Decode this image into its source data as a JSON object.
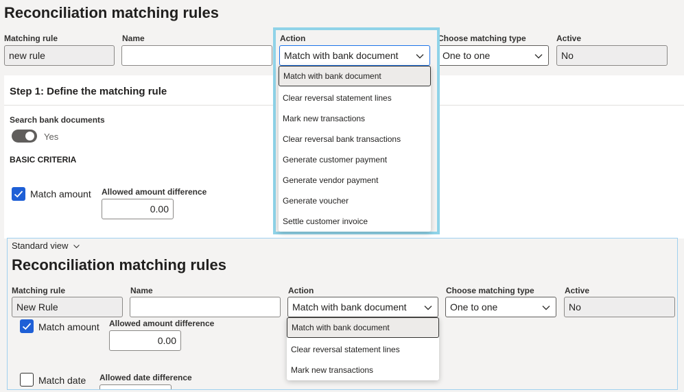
{
  "top": {
    "title": "Reconciliation matching rules",
    "labels": {
      "matching_rule": "Matching rule",
      "name": "Name",
      "action": "Action",
      "matching_type": "Choose matching type",
      "active": "Active"
    },
    "values": {
      "matching_rule": "new rule",
      "name": "",
      "action": "Match with bank document",
      "matching_type": "One to one",
      "active": "No"
    },
    "action_options": [
      "Match with bank document",
      "Clear reversal statement lines",
      "Mark new transactions",
      "Clear reversal bank transactions",
      "Generate customer payment",
      "Generate vendor payment",
      "Generate voucher",
      "Settle customer invoice"
    ],
    "step1": {
      "heading": "Step 1: Define the matching rule",
      "search_bank_documents_label": "Search bank documents",
      "toggle_value": "Yes",
      "basic_criteria": "BASIC CRITERIA",
      "match_amount_label": "Match amount",
      "allowed_amount_diff_label": "Allowed amount difference",
      "allowed_amount_diff_value": "0.00"
    }
  },
  "inset": {
    "view_selector": "Standard view",
    "title": "Reconciliation matching rules",
    "labels": {
      "matching_rule": "Matching rule",
      "name": "Name",
      "action": "Action",
      "matching_type": "Choose matching type",
      "active": "Active"
    },
    "values": {
      "matching_rule": "New Rule",
      "name": "",
      "action": "Match with bank document",
      "matching_type": "One to one",
      "active": "No"
    },
    "action_options": [
      "Match with bank document",
      "Clear reversal statement lines",
      "Mark new transactions"
    ],
    "match_amount_label": "Match amount",
    "allowed_amount_diff_label": "Allowed amount difference",
    "allowed_amount_diff_value": "0.00",
    "match_date_label": "Match date",
    "allowed_date_diff_label": "Allowed date difference"
  },
  "colors": {
    "highlight_border": "#8fd3e8",
    "accent": "#1e5fd6",
    "inset_border": "#9fd0ef"
  }
}
